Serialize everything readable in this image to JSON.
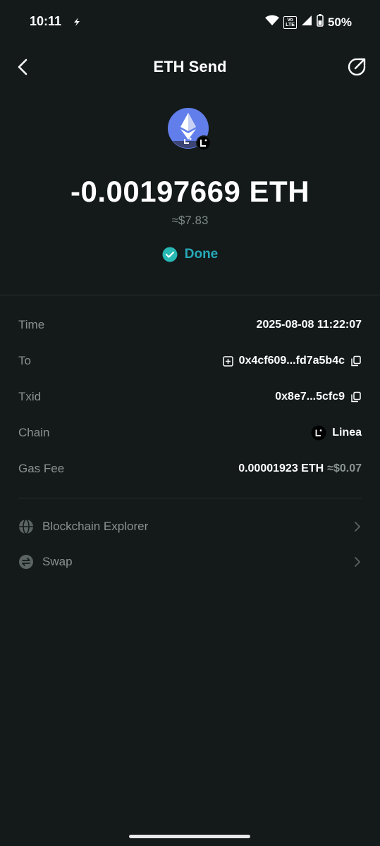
{
  "status_bar": {
    "time": "10:11",
    "network_badge_top": "Vo",
    "network_badge_bottom": "LTE",
    "battery": "50%"
  },
  "header": {
    "title": "ETH Send"
  },
  "transaction": {
    "amount": "-0.00197669 ETH",
    "fiat": "≈$7.83",
    "status": "Done"
  },
  "details": {
    "time_label": "Time",
    "time_value": "2025-08-08 11:22:07",
    "to_label": "To",
    "to_value": "0x4cf609...fd7a5b4c",
    "txid_label": "Txid",
    "txid_value": "0x8e7...5cfc9",
    "chain_label": "Chain",
    "chain_value": "Linea",
    "gas_label": "Gas Fee",
    "gas_value": "0.00001923 ETH",
    "gas_fiat": "≈$0.07"
  },
  "links": {
    "explorer_label": "Blockchain Explorer",
    "swap_label": "Swap"
  },
  "colors": {
    "background": "#141a1a",
    "accent": "#27a9b8",
    "eth_purple": "#627eea",
    "muted_text": "#8a9191"
  }
}
